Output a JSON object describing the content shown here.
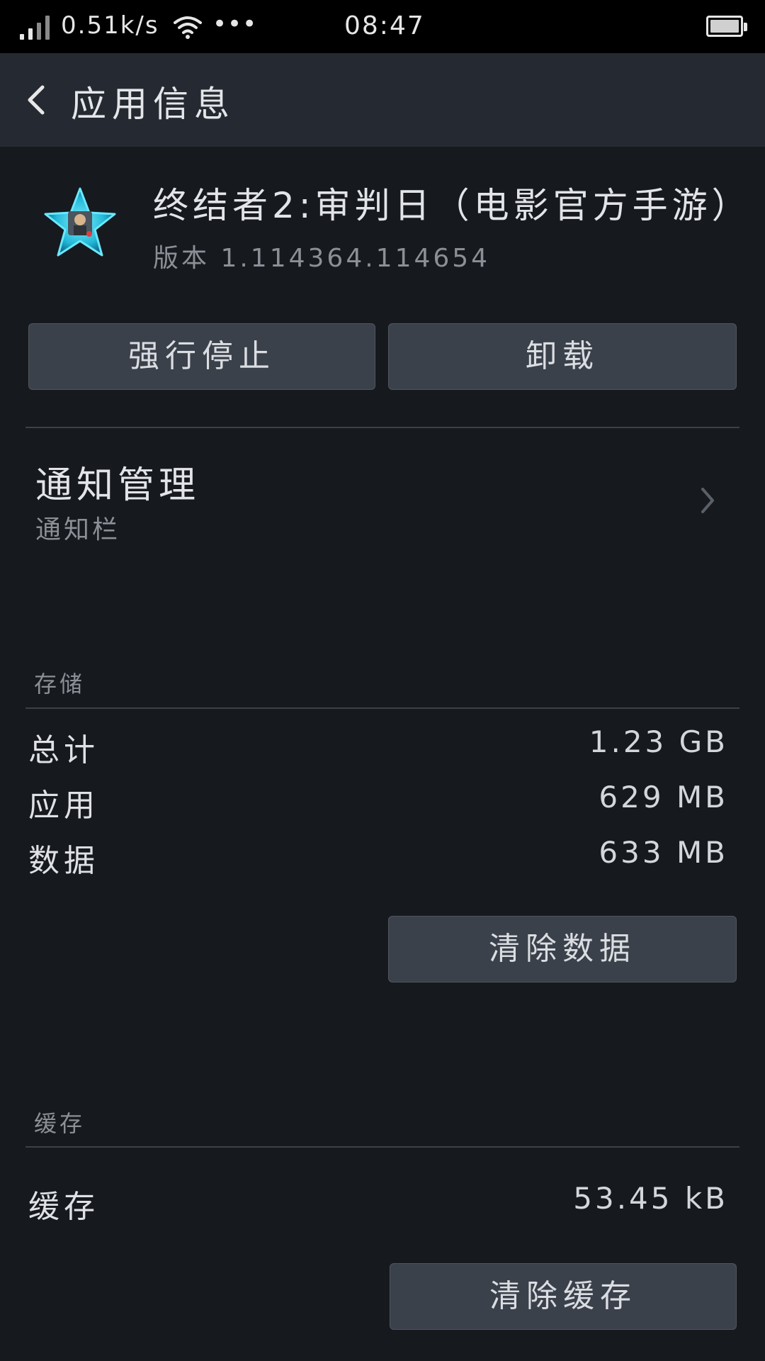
{
  "status_bar": {
    "net_speed": "0.51k/s",
    "more": "•••",
    "time": "08:47"
  },
  "title_bar": {
    "title": "应用信息"
  },
  "app": {
    "name": "终结者2:审判日（电影官方手游）",
    "version": "版本 1.114364.114654",
    "icon": "star-app-icon",
    "accent_color": "#31c6e6"
  },
  "actions": {
    "force_stop": "强行停止",
    "uninstall": "卸载"
  },
  "notification": {
    "title": "通知管理",
    "subtitle": "通知栏"
  },
  "storage": {
    "section_label": "存储",
    "rows": [
      {
        "label": "总计",
        "value": "1.23 GB"
      },
      {
        "label": "应用",
        "value": "629 MB"
      },
      {
        "label": "数据",
        "value": "633 MB"
      }
    ],
    "clear_data": "清除数据"
  },
  "cache": {
    "section_label": "缓存",
    "label": "缓存",
    "value": "53.45 kB",
    "clear_cache": "清除缓存"
  }
}
